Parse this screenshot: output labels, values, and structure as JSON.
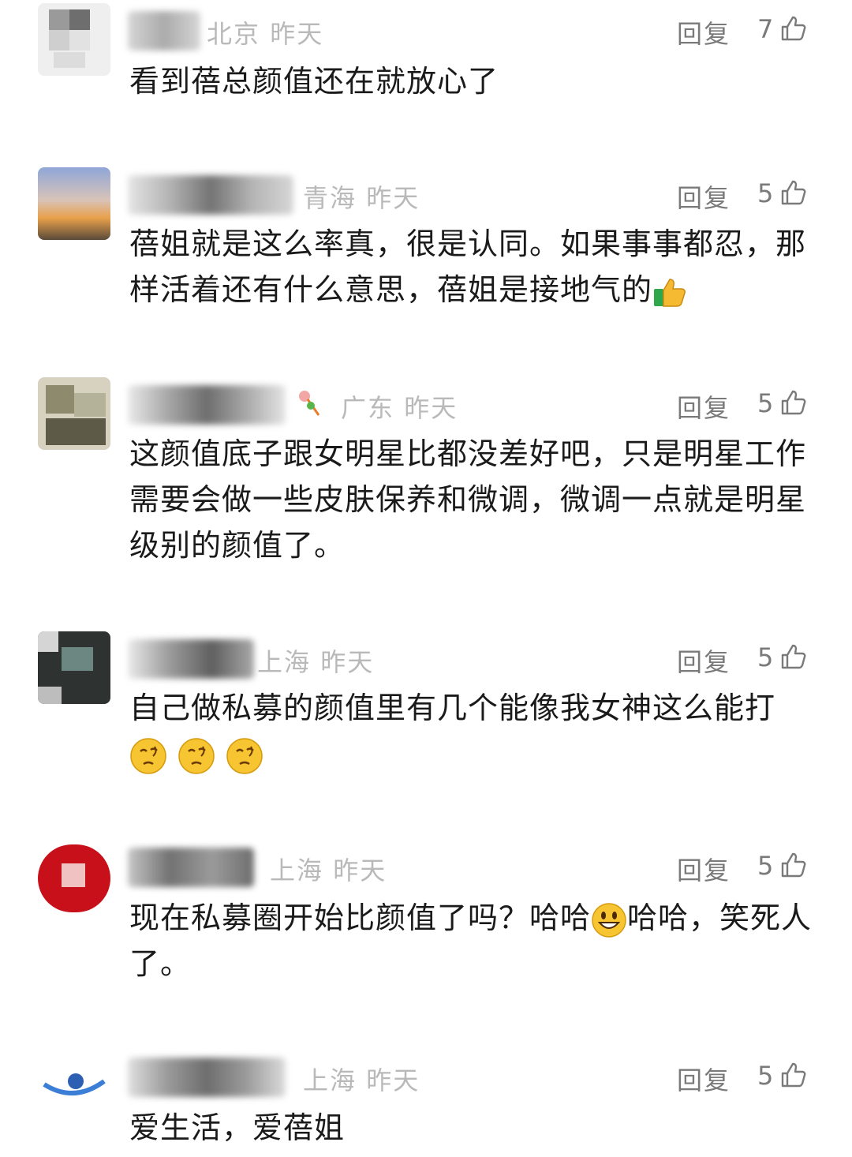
{
  "comments": [
    {
      "location": "北京",
      "time": "昨天",
      "reply_label": "回复",
      "likes": "7",
      "text": "看到蓓总颜值还在就放心了"
    },
    {
      "location": "青海",
      "time": "昨天",
      "reply_label": "回复",
      "likes": "5",
      "text": "蓓姐就是这么率真，很是认同。如果事事都忍，那样活着还有什么意思，蓓姐是接地气的",
      "trailing_emoji": "thumbs-up-emoji"
    },
    {
      "location": "广东",
      "time": "昨天",
      "reply_label": "回复",
      "likes": "5",
      "text": "这颜值底子跟女明星比都没差好吧，只是明星工作需要会做一些皮肤保养和微调，微调一点就是明星级别的颜值了。"
    },
    {
      "location": "上海",
      "time": "昨天",
      "reply_label": "回复",
      "likes": "5",
      "text": "自己做私募的颜值里有几个能像我女神这么能打",
      "trailing_emoji": "thinking-face-emoji x3"
    },
    {
      "location": "上海",
      "time": "昨天",
      "reply_label": "回复",
      "likes": "5",
      "text_part1": "现在私募圈开始比颜值了吗？哈哈",
      "text_part2": "哈哈，笑死人了。",
      "inline_emoji": "grinning-face-emoji"
    },
    {
      "location": "上海",
      "time": "昨天",
      "reply_label": "回复",
      "likes": "5",
      "text": "爱生活，爱蓓姐"
    }
  ],
  "colors": {
    "text": "#1a1a1a",
    "meta": "#b9b9b9",
    "action": "#7a7a7a"
  },
  "icons": {
    "like": "thumbs-up-outline-icon"
  }
}
